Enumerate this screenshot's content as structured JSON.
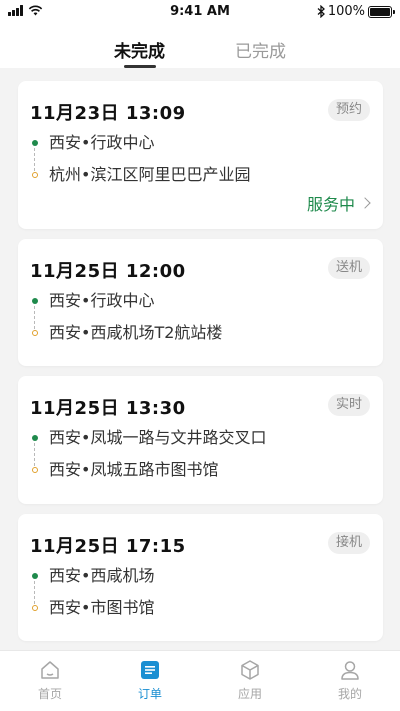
{
  "status_bar": {
    "time": "9:41 AM",
    "battery": "100%",
    "battery_level": 1.0
  },
  "tabs": [
    {
      "label": "未完成",
      "active": true
    },
    {
      "label": "已完成",
      "active": false
    }
  ],
  "orders": [
    {
      "time": "11月23日 13:09",
      "tag": "预约",
      "from": "西安•行政中心",
      "to": "杭州•滨江区阿里巴巴产业园",
      "status": "服务中"
    },
    {
      "time": "11月25日 12:00",
      "tag": "送机",
      "from": "西安•行政中心",
      "to": "西安•西咸机场T2航站楼"
    },
    {
      "time": "11月25日 13:30",
      "tag": "实时",
      "from": "西安•凤城一路与文井路交叉口",
      "to": "西安•凤城五路市图书馆"
    },
    {
      "time": "11月25日 17:15",
      "tag": "接机",
      "from": "西安•西咸机场",
      "to": "西安•市图书馆"
    }
  ],
  "bottom_nav": [
    {
      "label": "首页",
      "icon": "home-icon",
      "active": false
    },
    {
      "label": "订单",
      "icon": "order-icon",
      "active": true
    },
    {
      "label": "应用",
      "icon": "cube-icon",
      "active": false
    },
    {
      "label": "我的",
      "icon": "user-icon",
      "active": false
    }
  ],
  "colors": {
    "accent": "#1b8fd2",
    "green": "#1f8a4c",
    "orange": "#e0a02c"
  }
}
